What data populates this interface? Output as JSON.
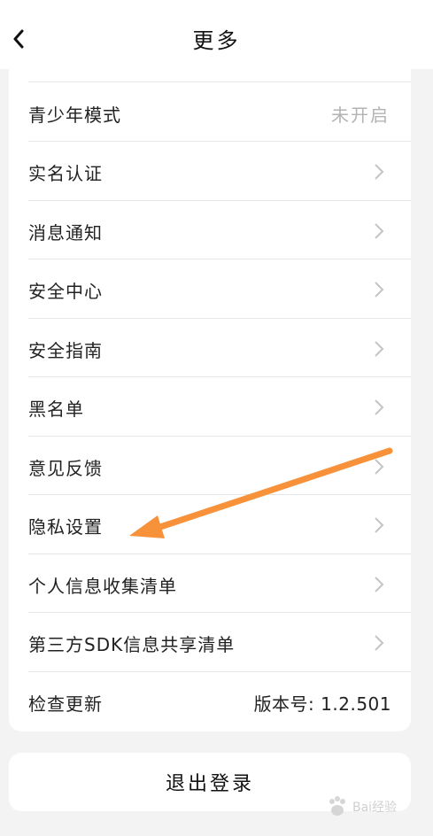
{
  "header": {
    "title": "更多"
  },
  "settings": {
    "items": [
      {
        "label": "青少年模式",
        "value": "未开启"
      },
      {
        "label": "实名认证"
      },
      {
        "label": "消息通知"
      },
      {
        "label": "安全中心"
      },
      {
        "label": "安全指南"
      },
      {
        "label": "黑名单"
      },
      {
        "label": "意见反馈"
      },
      {
        "label": "隐私设置"
      },
      {
        "label": "个人信息收集清单"
      },
      {
        "label": "第三方SDK信息共享清单"
      },
      {
        "label": "检查更新",
        "value": "版本号: 1.2.501"
      }
    ]
  },
  "logout": {
    "label": "退出登录"
  },
  "watermark": {
    "text": "Bai经验"
  },
  "colors": {
    "arrow": "#f7923a",
    "chevron": "#c4c4c4",
    "muted_text": "#b3b3b3"
  },
  "icons": {
    "back": "chevron-left-icon",
    "row_arrow": "chevron-right-icon"
  }
}
